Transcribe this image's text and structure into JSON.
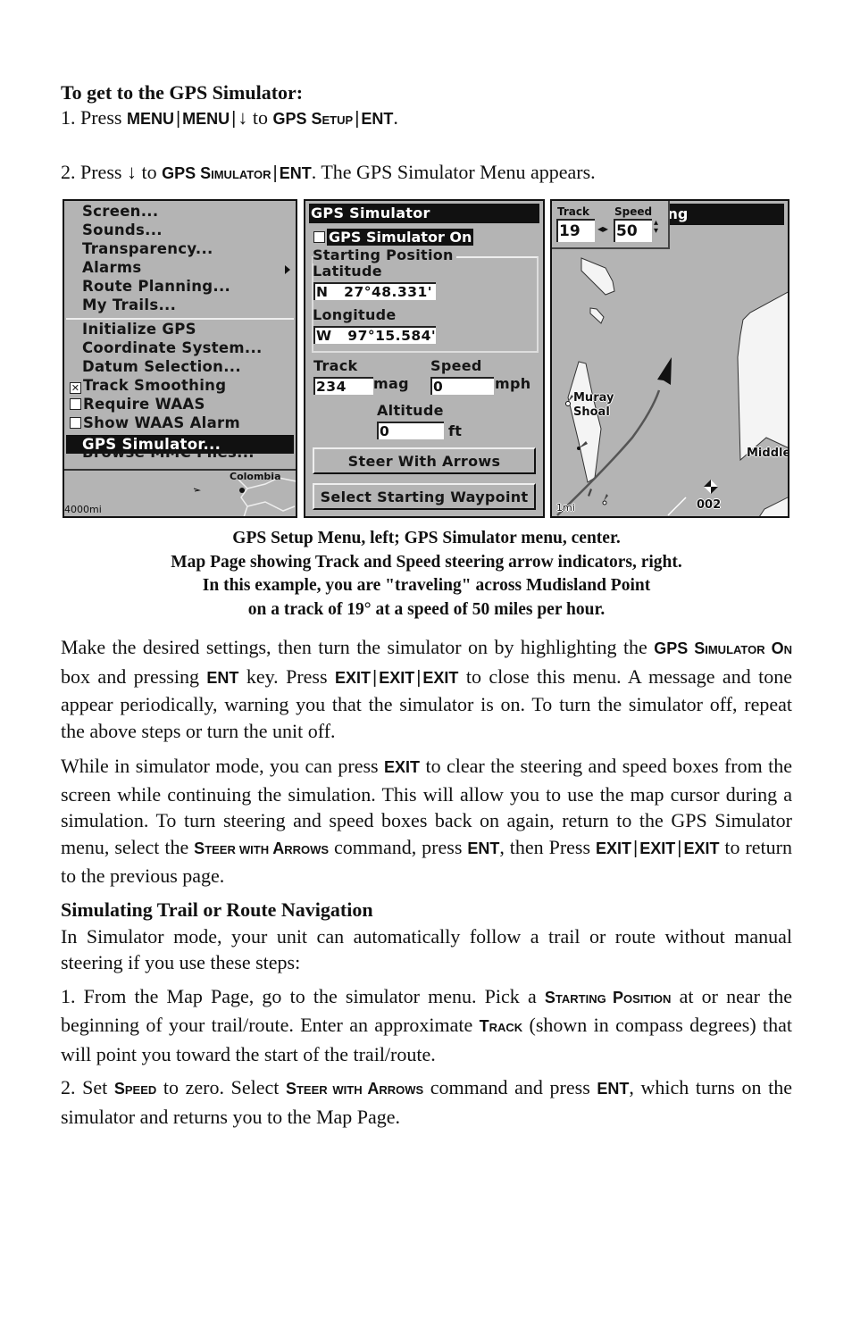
{
  "intro": {
    "heading": "To get to the GPS Simulator:",
    "step1": {
      "prefix": "1. Press ",
      "keys": [
        "MENU",
        "MENU",
        "↓"
      ],
      "mid": " to ",
      "target_a": "GPS S",
      "target_b": "ETUP",
      "end_key": "ENT",
      "suffix": "."
    },
    "step2": {
      "prefix": "2. Press ",
      "arrow": "↓",
      "mid": " to ",
      "target_a": "GPS S",
      "target_b": "IMULATOR",
      "end_key": "ENT",
      "suffix": ". The GPS Simulator Menu appears."
    }
  },
  "screens": {
    "gps_setup_menu": {
      "items": [
        {
          "label": "Screen..."
        },
        {
          "label": "Sounds..."
        },
        {
          "label": "Transparency..."
        },
        {
          "label": "Alarms",
          "submenu": true
        },
        {
          "label": "Route Planning..."
        },
        {
          "label": "My Trails..."
        },
        {
          "label": "Initialize GPS"
        },
        {
          "label": "Coordinate System..."
        },
        {
          "label": "Datum Selection..."
        }
      ],
      "checkbox_items": [
        {
          "label": "Track Smoothing",
          "checked": true,
          "mark": "✕"
        },
        {
          "label": "Require WAAS",
          "checked": false,
          "mark": ""
        },
        {
          "label": "Show WAAS Alarm",
          "checked": false,
          "mark": ""
        }
      ],
      "selected_item": "GPS Simulator...",
      "partially_hidden_item": "Browse MMC Files...",
      "minimap": {
        "country_label": "Colombia",
        "scale": "4000mi"
      }
    },
    "gps_simulator_menu": {
      "title": "GPS Simulator",
      "simulator_on": {
        "label": "GPS Simulator On",
        "checked": false
      },
      "starting_position_label": "Starting Position",
      "latitude_label": "Latitude",
      "latitude_value": "N   27°48.331'",
      "longitude_label": "Longitude",
      "longitude_value": "W   97°15.584'",
      "track_label": "Track",
      "track_value": "234",
      "track_unit": "mag",
      "speed_label": "Speed",
      "speed_value": "0",
      "speed_unit": "mph",
      "altitude_label": "Altitude",
      "altitude_value": "0",
      "altitude_unit": "ft",
      "steer_button": "Steer With Arrows",
      "waypoint_button": "Select Starting Waypoint"
    },
    "map_page": {
      "title_fragment": "ing",
      "track_label": "Track",
      "track_value": "19",
      "speed_label": "Speed",
      "speed_value": "50",
      "labels": {
        "shoal_1": "Muray",
        "shoal_2": "Shoal",
        "middle": "Middle",
        "waypoint": "002",
        "scale": "1mi"
      }
    }
  },
  "caption": [
    "GPS Setup Menu, left; GPS Simulator menu, center.",
    "Map Page showing Track and Speed steering arrow indicators, right.",
    "In this example, you are \"traveling\" across Mudisland Point",
    "on a track of 19° at a speed of 50 miles per hour."
  ],
  "body": {
    "para1": {
      "t1": "Make the desired settings, then turn the simulator on by highlighting the ",
      "k1a": "GPS S",
      "k1b": "IMULATOR",
      "k1c": " O",
      "k1d": "N",
      "t2": " box and pressing ",
      "k2": "ENT",
      "t3": " key. Press ",
      "k3": [
        "EXIT",
        "EXIT",
        "EXIT"
      ],
      "t4": " to close this menu. A message and tone appear periodically, warning you that the simulator is on. To turn the simulator off, repeat the above steps or turn the unit off."
    },
    "para2": {
      "t1": "While in simulator mode, you can press ",
      "k1": "EXIT",
      "t2": " to clear the steering and speed boxes from the screen while continuing the simulation. This will allow you to use the map cursor during a simulation. To turn steering and speed boxes back on again, return to the GPS Simulator menu, select the ",
      "k2a": "S",
      "k2b": "TEER WITH ",
      "k2c": "A",
      "k2d": "RROWS",
      "t3": " command, press ",
      "k3": "ENT",
      "t4": ", then Press ",
      "k4": [
        "EXIT",
        "EXIT",
        "EXIT"
      ],
      "t5": " to return to the previous page."
    },
    "section_heading": "Simulating Trail or Route Navigation",
    "para3": "In Simulator mode, your unit can automatically follow a trail or route without manual steering if you use these steps:",
    "para4": {
      "t1": "1. From the Map Page, go to the simulator menu. Pick a ",
      "k1a": "S",
      "k1b": "TARTING ",
      "k1c": "P",
      "k1d": "OSITION",
      "t2": " at or near the beginning of your trail/route. Enter an approximate ",
      "k2a": "T",
      "k2b": "RACK",
      "t3": " (shown in compass degrees) that will point you toward the start of the trail/route."
    },
    "para5": {
      "t1": "2. Set ",
      "k1a": "S",
      "k1b": "PEED",
      "t2": " to zero. Select ",
      "k2a": "S",
      "k2b": "TEER WITH ",
      "k2c": "A",
      "k2d": "RROWS",
      "t3": " command and press ",
      "k3": "ENT",
      "t4": ", which turns on the simulator and returns you to the Map Page."
    }
  }
}
